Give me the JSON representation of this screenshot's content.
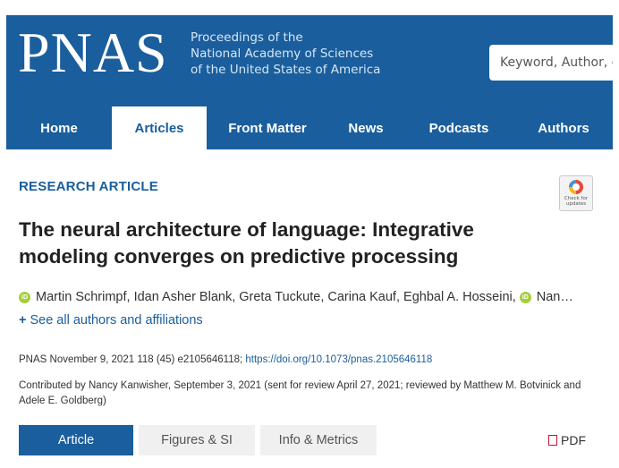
{
  "header": {
    "logo": "PNAS",
    "tagline": [
      "Proceedings of the",
      "National Academy of Sciences",
      "of the United States of America"
    ],
    "search_placeholder": "Keyword, Author, or"
  },
  "nav": {
    "items": [
      {
        "label": "Home",
        "active": false
      },
      {
        "label": "Articles",
        "active": true
      },
      {
        "label": "Front Matter",
        "active": false
      },
      {
        "label": "News",
        "active": false
      },
      {
        "label": "Podcasts",
        "active": false
      },
      {
        "label": "Authors",
        "active": false
      }
    ]
  },
  "article": {
    "kicker": "RESEARCH ARTICLE",
    "check_badge": "Check for updates",
    "title_lines": [
      "The neural architecture of language: Integrative",
      "modeling converges on predictive processing"
    ],
    "authors_text": "Martin Schrimpf, Idan Asher Blank, Greta Tuckute, Carina Kauf, Eghbal A. Hosseini,",
    "authors_trailing": "Nan…",
    "see_all": "See all authors and affiliations",
    "citation": "PNAS November 9, 2021 118 (45) e2105646118; ",
    "doi": "https://doi.org/10.1073/pnas.2105646118",
    "contributed": "Contributed by Nancy Kanwisher, September 3, 2021 (sent for review April 27, 2021; reviewed by Matthew M. Botvinick and Adele E. Goldberg)"
  },
  "tabs": {
    "items": [
      {
        "label": "Article",
        "active": true
      },
      {
        "label": "Figures & SI",
        "active": false
      },
      {
        "label": "Info & Metrics",
        "active": false
      }
    ],
    "pdf_label": "PDF"
  },
  "colors": {
    "brand": "#1a5e9d",
    "orcid": "#a6ce39",
    "pdf_icon": "#c8102e"
  }
}
